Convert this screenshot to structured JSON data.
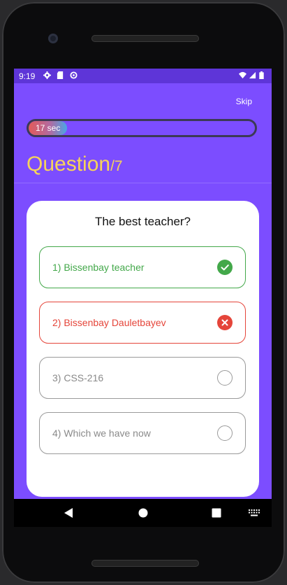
{
  "status_bar": {
    "time": "9:19",
    "icons": [
      "gear-icon",
      "sd-card-icon",
      "sync-icon",
      "wifi-icon",
      "signal-icon",
      "battery-icon"
    ]
  },
  "header": {
    "skip_label": "Skip"
  },
  "timer": {
    "text": "17 sec"
  },
  "question_header": {
    "word": "Question",
    "total": "/7"
  },
  "card": {
    "question": "The best teacher?",
    "options": [
      {
        "label": "1) Bissenbay teacher",
        "state": "correct",
        "icon": "check-icon"
      },
      {
        "label": "2) Bissenbay Dauletbayev",
        "state": "wrong",
        "icon": "close-icon"
      },
      {
        "label": "3) CSS-216",
        "state": "empty",
        "icon": "radio-empty-icon"
      },
      {
        "label": "4) Which we have now",
        "state": "empty",
        "icon": "radio-empty-icon"
      }
    ]
  },
  "nav_bar": {
    "buttons": [
      "back-icon",
      "home-icon",
      "recents-icon",
      "keyboard-icon"
    ]
  },
  "colors": {
    "background": "#7c4dff",
    "status_bar": "#5e35d8",
    "title": "#f6d35a",
    "correct": "#43a84a",
    "wrong": "#e5453a"
  }
}
